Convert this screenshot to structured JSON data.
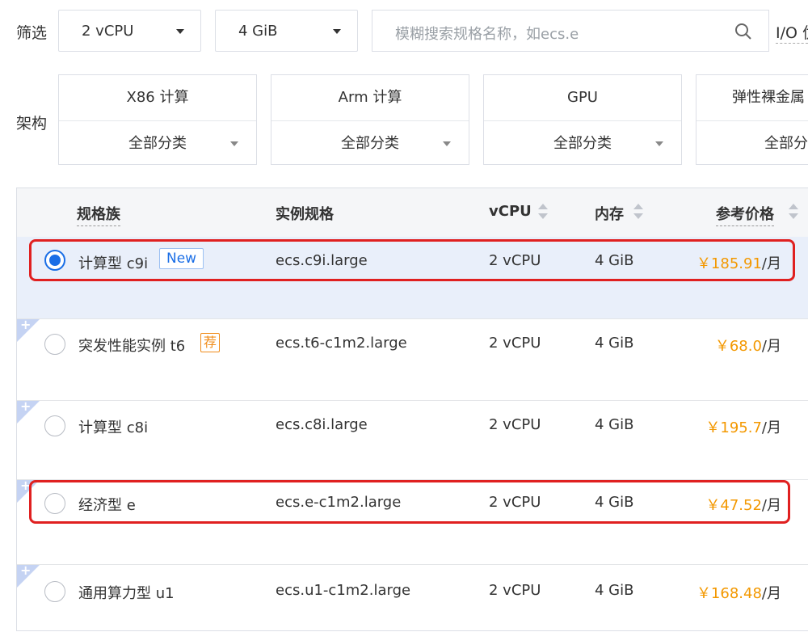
{
  "filter": {
    "label": "筛选",
    "vcpu_select": "2 vCPU",
    "memory_select": "4 GiB",
    "search_placeholder": "模糊搜索规格名称，如ecs.e",
    "io_label": "I/O 优"
  },
  "architecture": {
    "label": "架构",
    "cards": [
      {
        "title": "X86 计算",
        "sub": "全部分类"
      },
      {
        "title": "Arm 计算",
        "sub": "全部分类"
      },
      {
        "title": "GPU",
        "sub": "全部分类"
      },
      {
        "title": "弹性裸金属",
        "sub": "全部分"
      }
    ]
  },
  "table": {
    "headers": {
      "family": "规格族",
      "spec": "实例规格",
      "vcpu": "vCPU",
      "memory": "内存",
      "price": "参考价格"
    },
    "rows": [
      {
        "family": "计算型 c9i",
        "badge": "New",
        "spec": "ecs.c9i.large",
        "vcpu": "2 vCPU",
        "memory": "4 GiB",
        "price": "￥185.91",
        "unit": "/月",
        "selected": true
      },
      {
        "family": "突发性能实例 t6",
        "badge": "荐",
        "spec": "ecs.t6-c1m2.large",
        "vcpu": "2 vCPU",
        "memory": "4 GiB",
        "price": "￥68.0",
        "unit": "/月",
        "selected": false
      },
      {
        "family": "计算型 c8i",
        "spec": "ecs.c8i.large",
        "vcpu": "2 vCPU",
        "memory": "4 GiB",
        "price": "￥195.7",
        "unit": "/月",
        "selected": false
      },
      {
        "family": "经济型 e",
        "spec": "ecs.e-c1m2.large",
        "vcpu": "2 vCPU",
        "memory": "4 GiB",
        "price": "￥47.52",
        "unit": "/月",
        "selected": false
      },
      {
        "family": "通用算力型 u1",
        "spec": "ecs.u1-c1m2.large",
        "vcpu": "2 vCPU",
        "memory": "4 GiB",
        "price": "￥168.48",
        "unit": "/月",
        "selected": false
      }
    ]
  },
  "colors": {
    "accent": "#1a6ee6",
    "price": "#f39800",
    "highlight": "#e02020",
    "selected_row": "#e9effa"
  }
}
